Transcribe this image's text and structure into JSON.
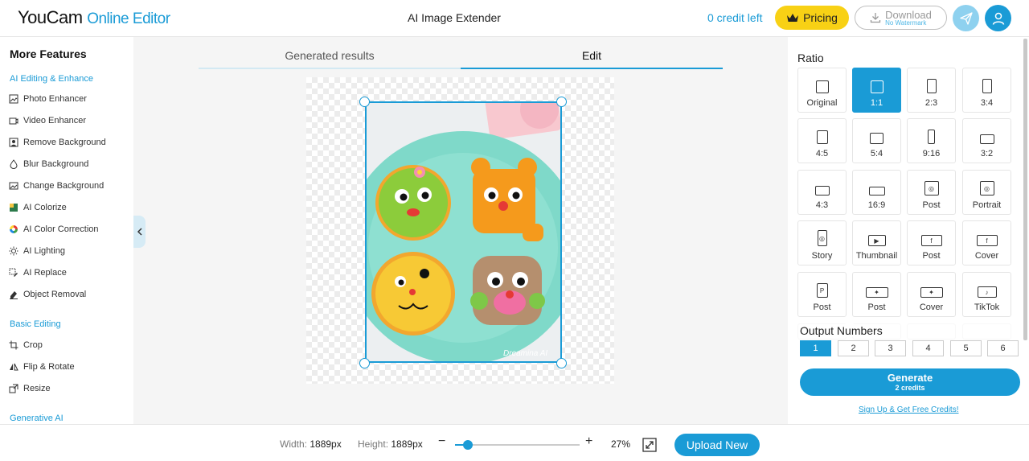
{
  "header": {
    "logo_brand": "YouCam",
    "logo_sub": "Online Editor",
    "page_title": "AI Image Extender",
    "credits": "0 credit left",
    "pricing_label": "Pricing",
    "download_label": "Download",
    "download_sub": "No Watermark"
  },
  "sidebar": {
    "title": "More Features",
    "sections": [
      {
        "title": "AI Editing & Enhance"
      },
      {
        "title": "Basic Editing"
      },
      {
        "title": "Generative AI"
      }
    ],
    "ai_items": [
      {
        "label": "Photo Enhancer",
        "icon": "photo-enhancer-icon"
      },
      {
        "label": "Video Enhancer",
        "icon": "video-enhancer-icon"
      },
      {
        "label": "Remove Background",
        "icon": "remove-background-icon"
      },
      {
        "label": "Blur Background",
        "icon": "blur-background-icon"
      },
      {
        "label": "Change Background",
        "icon": "change-background-icon"
      },
      {
        "label": "AI Colorize",
        "icon": "colorize-icon"
      },
      {
        "label": "AI Color Correction",
        "icon": "color-wheel-icon"
      },
      {
        "label": "AI Lighting",
        "icon": "lighting-icon"
      },
      {
        "label": "AI Replace",
        "icon": "replace-icon"
      },
      {
        "label": "Object Removal",
        "icon": "eraser-icon"
      }
    ],
    "basic_items": [
      {
        "label": "Crop",
        "icon": "crop-icon"
      },
      {
        "label": "Flip & Rotate",
        "icon": "flip-icon"
      },
      {
        "label": "Resize",
        "icon": "resize-icon"
      }
    ]
  },
  "tabs": {
    "generated": "Generated results",
    "edit": "Edit"
  },
  "canvas": {
    "watermark": "Dreamina AI"
  },
  "ratio_panel": {
    "title": "Ratio",
    "options": [
      {
        "label": "Original",
        "shape": "square",
        "selected": false
      },
      {
        "label": "1:1",
        "shape": "square",
        "selected": true
      },
      {
        "label": "2:3",
        "shape": "tall",
        "selected": false
      },
      {
        "label": "3:4",
        "shape": "tall",
        "selected": false
      },
      {
        "label": "4:5",
        "shape": "tall-slight",
        "selected": false
      },
      {
        "label": "5:4",
        "shape": "wide-slight",
        "selected": false
      },
      {
        "label": "9:16",
        "shape": "very-tall",
        "selected": false
      },
      {
        "label": "3:2",
        "shape": "wide",
        "selected": false
      },
      {
        "label": "4:3",
        "shape": "wide",
        "selected": false
      },
      {
        "label": "16:9",
        "shape": "very-wide",
        "selected": false
      },
      {
        "label": "Post",
        "shape": "instagram",
        "selected": false
      },
      {
        "label": "Portrait",
        "shape": "instagram",
        "selected": false
      },
      {
        "label": "Story",
        "shape": "instagram-tall",
        "selected": false
      },
      {
        "label": "Thumbnail",
        "shape": "youtube",
        "selected": false
      },
      {
        "label": "Post",
        "shape": "facebook",
        "selected": false
      },
      {
        "label": "Cover",
        "shape": "facebook",
        "selected": false
      },
      {
        "label": "Post",
        "shape": "pinterest",
        "selected": false
      },
      {
        "label": "Post",
        "shape": "twitter",
        "selected": false
      },
      {
        "label": "Cover",
        "shape": "twitter",
        "selected": false
      },
      {
        "label": "TikTok",
        "shape": "tiktok",
        "selected": false
      }
    ],
    "output_title": "Output Numbers",
    "output_options": [
      "1",
      "2",
      "3",
      "4",
      "5",
      "6"
    ],
    "output_selected": "1",
    "generate_label": "Generate",
    "generate_sub": "2 credits",
    "signup_label": "Sign Up & Get Free Credits!"
  },
  "bottom": {
    "width_label": "Width:",
    "width_value": "1889px",
    "height_label": "Height:",
    "height_value": "1889px",
    "zoom_minus": "−",
    "zoom_plus": "+",
    "zoom_value": "27%",
    "zoom_level": 0.09,
    "upload_label": "Upload New"
  },
  "colors": {
    "accent": "#1a9bd6",
    "pricing": "#f8d115"
  }
}
